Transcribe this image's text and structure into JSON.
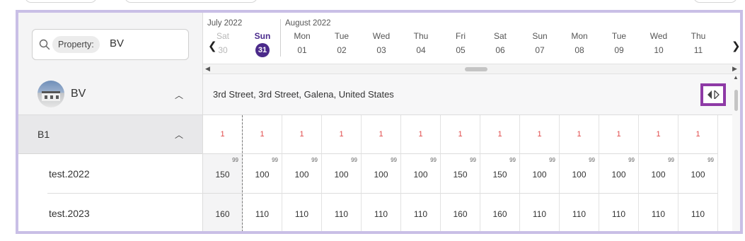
{
  "search": {
    "chip_label": "Property:",
    "value": "BV"
  },
  "property": {
    "name": "BV",
    "address": "3rd Street, 3rd Street, Galena, United States"
  },
  "room": {
    "name": "B1"
  },
  "rate_plans": [
    {
      "name": "test.2022"
    },
    {
      "name": "test.2023"
    }
  ],
  "calendar": {
    "months": [
      "July 2022",
      "August 2022"
    ],
    "days": [
      {
        "dow": "Sat",
        "date": "30",
        "state": "past"
      },
      {
        "dow": "Sun",
        "date": "31",
        "state": "today"
      },
      {
        "dow": "Mon",
        "date": "01"
      },
      {
        "dow": "Tue",
        "date": "02"
      },
      {
        "dow": "Wed",
        "date": "03"
      },
      {
        "dow": "Thu",
        "date": "04"
      },
      {
        "dow": "Fri",
        "date": "05"
      },
      {
        "dow": "Sat",
        "date": "06"
      },
      {
        "dow": "Sun",
        "date": "07"
      },
      {
        "dow": "Mon",
        "date": "08"
      },
      {
        "dow": "Tue",
        "date": "09"
      },
      {
        "dow": "Wed",
        "date": "10"
      },
      {
        "dow": "Thu",
        "date": "11"
      }
    ],
    "nav": {
      "prev": "‹",
      "next": "›"
    }
  },
  "availability": [
    "1",
    "1",
    "1",
    "1",
    "1",
    "1",
    "1",
    "1",
    "1",
    "1",
    "1",
    "1",
    "1"
  ],
  "rates": {
    "mini_label": "99",
    "rows": [
      [
        "150",
        "100",
        "100",
        "100",
        "100",
        "100",
        "150",
        "150",
        "100",
        "100",
        "100",
        "100",
        "100"
      ],
      [
        "160",
        "110",
        "110",
        "110",
        "110",
        "110",
        "160",
        "160",
        "110",
        "110",
        "110",
        "110",
        "110"
      ]
    ]
  },
  "colors": {
    "accent": "#4b2a8a",
    "frame": "#c9bfe6",
    "availability": "#e14b4b",
    "highlight": "#8e3aa6"
  }
}
